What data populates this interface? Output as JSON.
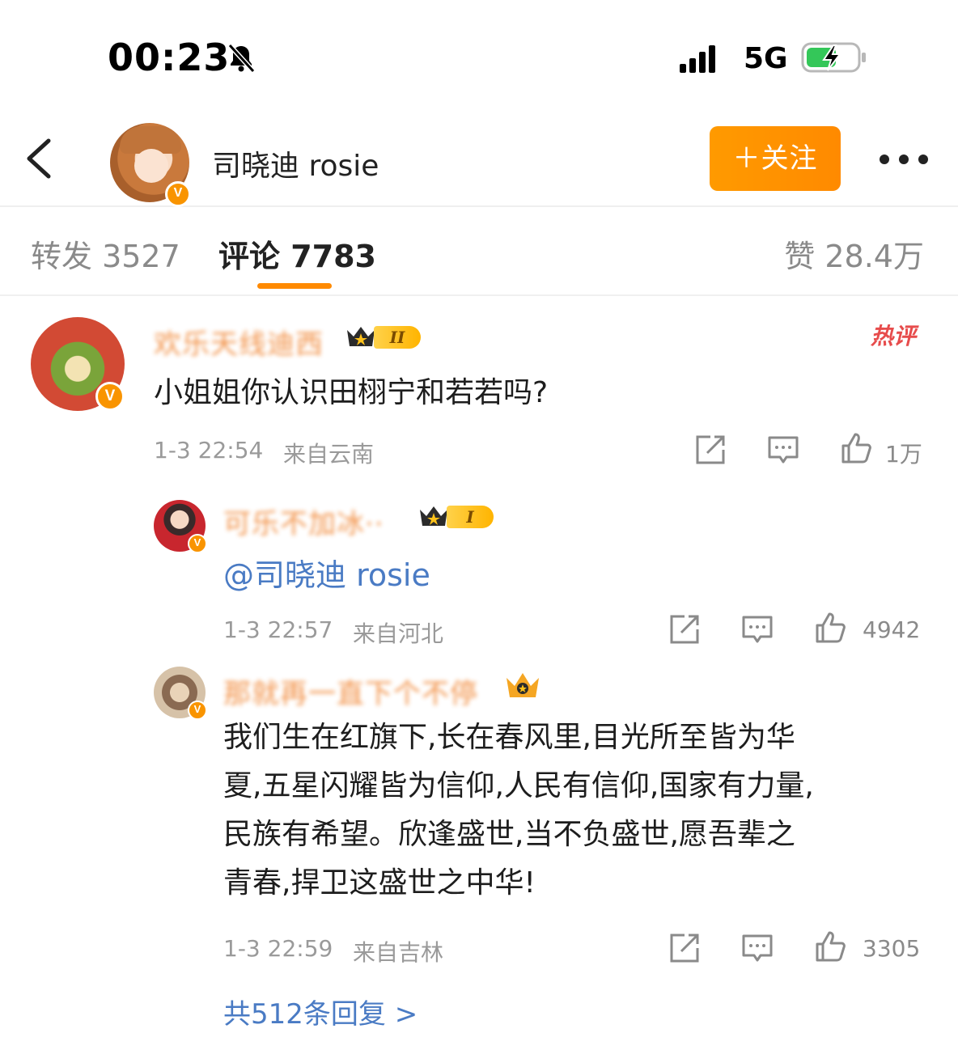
{
  "status_bar": {
    "time": "00:23",
    "network": "5G"
  },
  "header": {
    "name": "司晓迪 rosie",
    "follow_label": "＋关注"
  },
  "tabs": {
    "forward": "转发 3527",
    "comments": "评论 7783",
    "likes": "赞 28.4万"
  },
  "comment": {
    "username": "欢乐天线迪西",
    "level": "II",
    "hot_label": "热评",
    "text": "小姐姐你认识田栩宁和若若吗?",
    "time": "1-3 22:54",
    "location": "来自云南",
    "likes": "1万"
  },
  "replies": [
    {
      "username": "可乐不加冰··",
      "level": "I",
      "text": "@司晓迪 rosie",
      "time": "1-3 22:57",
      "location": "来自河北",
      "likes": "4942"
    },
    {
      "username": "那就再一直下个不停",
      "text_lines": [
        "我们生在红旗下,长在春风里,目光所至皆为华",
        "夏,五星闪耀皆为信仰,人民有信仰,国家有力量,",
        "民族有希望。欣逢盛世,当不负盛世,愿吾辈之",
        "青春,捍卫这盛世之中华!"
      ],
      "time": "1-3 22:59",
      "location": "来自吉林",
      "likes": "3305"
    }
  ],
  "more_replies": "共512条回复 >",
  "colors": {
    "accent": "#ff8a00",
    "link": "#4a7bc4",
    "username": "#f0802a",
    "hot": "#e74c4c"
  }
}
